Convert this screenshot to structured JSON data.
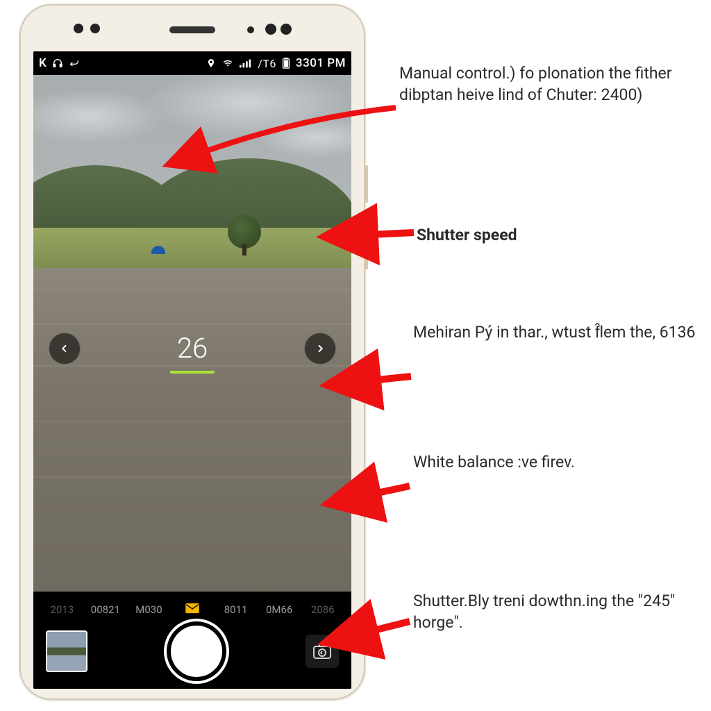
{
  "statusbar": {
    "left_letter": "K",
    "carrier": "/T6",
    "clock": "3301 PM"
  },
  "viewfinder": {
    "stepper_value": "26"
  },
  "mode_row": {
    "items": [
      "2013",
      "00821",
      "M030",
      "mail-icon",
      "8011",
      "0M66",
      "2086"
    ]
  },
  "annotations": {
    "a1": "Manual control.) fo plonation the fither dibptan heive lind of Chuter: 2400)",
    "a2": "Shutter speed",
    "a3": "Mehiran Pý in thar., wtust f̂lem the, 6136",
    "a4": "White balance :ve firev.",
    "a5": "Shutter.Bly treni dowthn.ing the \"245\" horge\"."
  }
}
